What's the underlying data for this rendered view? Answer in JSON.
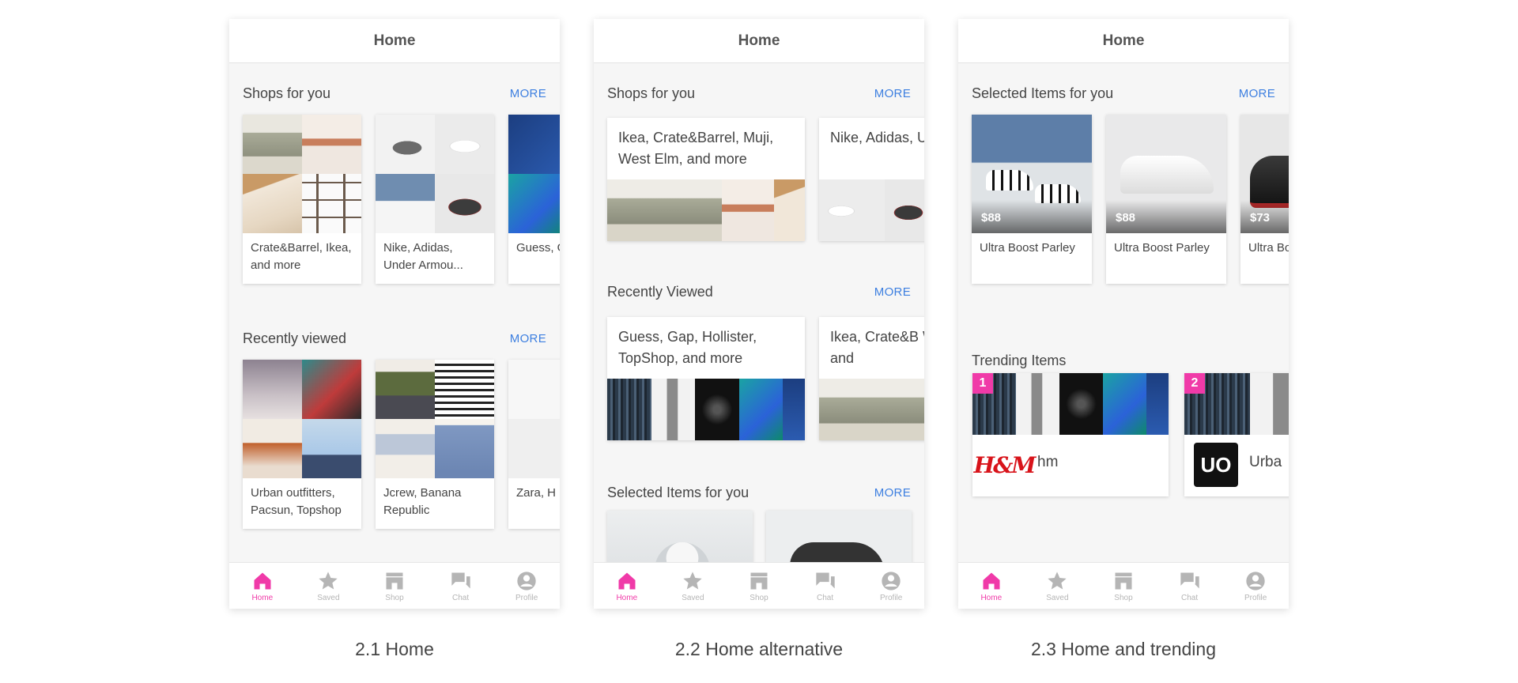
{
  "screens": [
    {
      "header": "Home",
      "sections": [
        {
          "title": "Shops for you",
          "more": "MORE",
          "cards": [
            {
              "caption": "Crate&Barrel, Ikea, and more"
            },
            {
              "caption": "Nike, Adidas, Under Armou..."
            },
            {
              "caption": "Guess, G Topshop"
            }
          ]
        },
        {
          "title": "Recently viewed",
          "more": "MORE",
          "cards": [
            {
              "caption": "Urban outfitters, Pacsun, Topshop"
            },
            {
              "caption": "Jcrew, Banana Republic"
            },
            {
              "caption": "Zara, H"
            }
          ]
        }
      ],
      "caption": "2.1 Home"
    },
    {
      "header": "Home",
      "sections": [
        {
          "title": "Shops for you",
          "more": "MORE",
          "cards": [
            {
              "caption": "Ikea, Crate&Barrel, Muji, West Elm, and more"
            },
            {
              "caption": "Nike, Adidas, UnderArmou"
            }
          ]
        },
        {
          "title": "Recently Viewed",
          "more": "MORE",
          "cards": [
            {
              "caption": "Guess, Gap, Hollister, TopShop, and more"
            },
            {
              "caption": "Ikea, Crate&B West Elm, and"
            }
          ]
        },
        {
          "title": "Selected Items for you",
          "more": "MORE"
        }
      ],
      "caption": "2.2 Home alternative"
    },
    {
      "header": "Home",
      "sections": [
        {
          "title": "Selected Items for you",
          "more": "MORE",
          "items": [
            {
              "price": "$88",
              "name": "Ultra Boost Parley"
            },
            {
              "price": "$88",
              "name": "Ultra Boost Parley"
            },
            {
              "price": "$73",
              "name": "Ultra Bo Parley"
            }
          ]
        },
        {
          "title": "Trending Items",
          "trending": [
            {
              "rank": "1",
              "logo": "H&M",
              "name": "hm"
            },
            {
              "rank": "2",
              "logo": "UO",
              "name": "Urba"
            }
          ]
        }
      ],
      "caption": "2.3 Home and trending"
    }
  ],
  "tabbar": [
    {
      "label": "Home",
      "icon": "home-icon",
      "active": true
    },
    {
      "label": "Saved",
      "icon": "star-icon",
      "active": false
    },
    {
      "label": "Shop",
      "icon": "shop-icon",
      "active": false
    },
    {
      "label": "Chat",
      "icon": "chat-icon",
      "active": false
    },
    {
      "label": "Profile",
      "icon": "profile-icon",
      "active": false
    }
  ],
  "colors": {
    "accent": "#f03aa8",
    "link": "#3d7fe0"
  }
}
